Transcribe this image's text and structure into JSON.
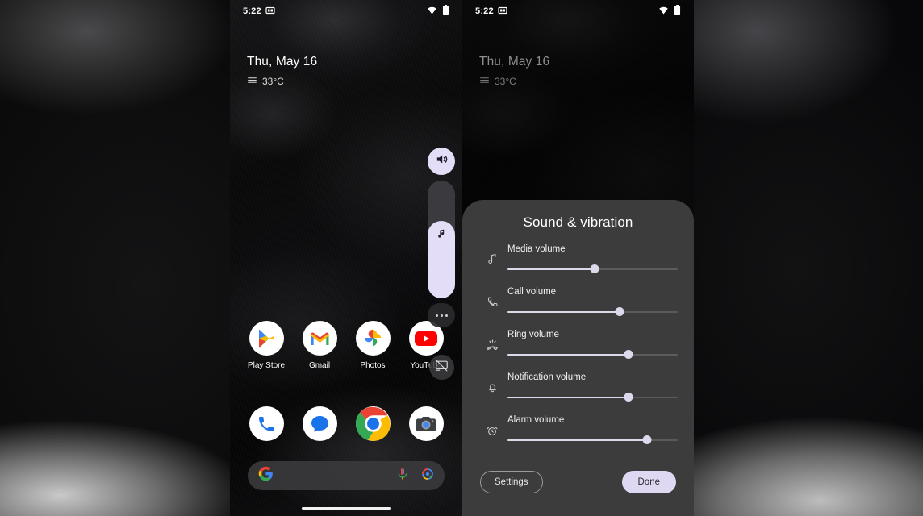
{
  "left_phone": {
    "status_bar": {
      "time": "5:22",
      "icons": [
        "screenshot-icon",
        "wifi-icon",
        "battery-icon"
      ]
    },
    "clock_widget": {
      "date": "Thu, May 16",
      "temperature": "33°C",
      "weather_icon": "haze-icon"
    },
    "app_rows": [
      [
        {
          "label": "Play Store",
          "icon": "play-store-icon"
        },
        {
          "label": "Gmail",
          "icon": "gmail-icon"
        },
        {
          "label": "Photos",
          "icon": "google-photos-icon"
        },
        {
          "label": "YouTube",
          "icon": "youtube-icon"
        }
      ],
      [
        {
          "label": "",
          "icon": "phone-icon"
        },
        {
          "label": "",
          "icon": "messages-icon"
        },
        {
          "label": "",
          "icon": "chrome-icon"
        },
        {
          "label": "",
          "icon": "camera-icon"
        }
      ]
    ],
    "search_pill": {
      "logo_icon": "google-g-icon",
      "mic_icon": "microphone-icon",
      "lens_icon": "google-lens-icon",
      "placeholder": ""
    },
    "volume_rocker": {
      "speaker_icon": "volume-up-icon",
      "stream_icon": "music-note-icon",
      "level_percent": 66,
      "more_icon": "overflow-menu-icon",
      "cast_icon": "cast-off-icon"
    }
  },
  "right_phone": {
    "status_bar": {
      "time": "5:22",
      "icons": [
        "screenshot-icon",
        "wifi-icon",
        "battery-icon"
      ]
    },
    "clock_widget": {
      "date": "Thu, May 16",
      "temperature": "33°C",
      "weather_icon": "haze-icon"
    }
  },
  "dialog": {
    "title": "Sound & vibration",
    "sliders": [
      {
        "label": "Media volume",
        "icon": "music-note-icon",
        "value_percent": 51
      },
      {
        "label": "Call volume",
        "icon": "phone-call-icon",
        "value_percent": 66
      },
      {
        "label": "Ring volume",
        "icon": "ring-volume-icon",
        "value_percent": 71
      },
      {
        "label": "Notification volume",
        "icon": "bell-icon",
        "value_percent": 71
      },
      {
        "label": "Alarm volume",
        "icon": "alarm-clock-icon",
        "value_percent": 82
      }
    ],
    "settings_label": "Settings",
    "done_label": "Done"
  },
  "colors": {
    "accent": "#ded8f2",
    "dialog_bg": "#3c3c3c",
    "track_inactive": "#5b5b5b",
    "text_primary": "#ffffff"
  }
}
